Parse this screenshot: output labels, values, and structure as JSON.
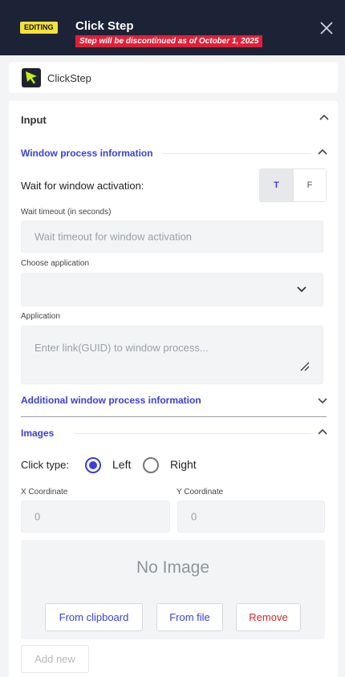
{
  "header": {
    "badge": "EDITING",
    "title": "Click Step",
    "warning": "Step will be discontinued as of October 1, 2025"
  },
  "step": {
    "name": "ClickStep"
  },
  "input_section": {
    "title": "Input",
    "window_process": {
      "title": "Window process information",
      "wait_activation_label": "Wait for window activation:",
      "toggle_true": "T",
      "toggle_false": "F",
      "toggle_selected": "T",
      "wait_timeout_label": "Wait timeout (in seconds)",
      "wait_timeout_placeholder": "Wait timeout for window activation",
      "choose_application_label": "Choose application",
      "choose_application_value": "",
      "application_label": "Application",
      "application_placeholder": "Enter link(GUID) to window process..."
    },
    "additional_title": "Additional window process information"
  },
  "images_section": {
    "title": "Images",
    "click_type_label": "Click type:",
    "click_left": "Left",
    "click_right": "Right",
    "click_selected": "Left",
    "x_label": "X Coordinate",
    "x_value": "0",
    "y_label": "Y Coordinate",
    "y_value": "0",
    "no_image": "No Image",
    "from_clipboard": "From clipboard",
    "from_file": "From file",
    "remove": "Remove",
    "add_new": "Add new"
  },
  "icons": {
    "close": "close-icon",
    "step": "cursor-arrow-icon",
    "collapse": "chevron-up-icon",
    "expand": "chevron-down-icon",
    "resize": "resize-handle-icon"
  },
  "colors": {
    "header_bg": "#1d2336",
    "badge": "#f5e23a",
    "warning": "#e0203a",
    "accent": "#3a3fd6",
    "danger": "#d9262c",
    "step_icon_arrow": "#c7ea1f"
  }
}
